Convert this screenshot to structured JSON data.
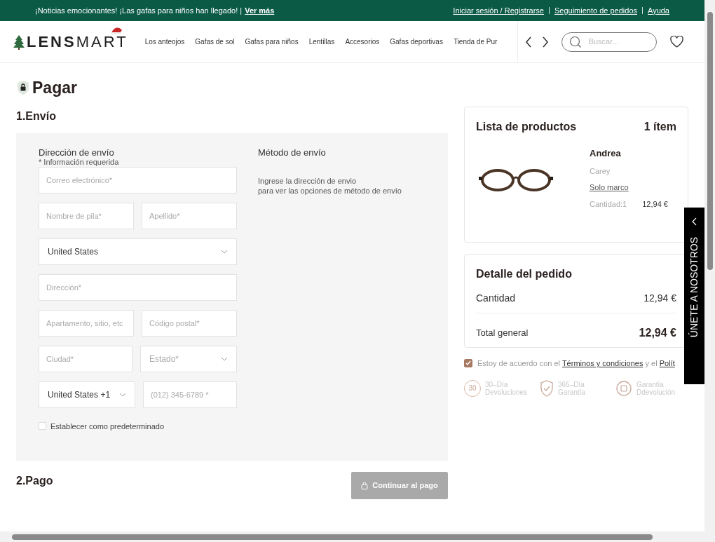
{
  "announcement": {
    "text": "¡Noticias emocionantes! ¡Las gafas para niños han llegado! |",
    "link": "Ver más"
  },
  "top_links": [
    "Iniciar sesión / Registrarse",
    "Seguimiento de pedidos",
    "Ayuda"
  ],
  "logo": {
    "bold": "LENS",
    "light": "MART"
  },
  "nav": [
    "Los anteojos",
    "Gafas de sol",
    "Gafas para niños",
    "Lentillas",
    "Accesorios",
    "Gafas deportivas",
    "Tienda de Pur"
  ],
  "search": {
    "placeholder": "Buscar..."
  },
  "page_title": "Pagar",
  "shipping": {
    "heading": "1.Envío",
    "address_title": "Dirección de envío",
    "required_note": "* Información requerida",
    "rows": [
      [
        {
          "kind": "input",
          "placeholder": "Correo electrónico*"
        }
      ],
      [
        {
          "kind": "input",
          "placeholder": "Nombre de pila*"
        },
        {
          "kind": "input",
          "placeholder": "Apellido*"
        }
      ],
      [
        {
          "kind": "select",
          "value": "United States"
        }
      ],
      [
        {
          "kind": "input",
          "placeholder": "Dirección*"
        }
      ],
      [
        {
          "kind": "input",
          "placeholder": "Apartamento, sitio, etc"
        },
        {
          "kind": "input",
          "placeholder": "Código postal*"
        }
      ],
      [
        {
          "kind": "input",
          "placeholder": "Ciudad*"
        },
        {
          "kind": "select",
          "placeholder": "Estado*"
        }
      ],
      [
        {
          "kind": "select",
          "value": "United States +1"
        },
        {
          "kind": "input",
          "placeholder": "(012) 345-6789 *"
        }
      ]
    ],
    "default_checkbox": {
      "label": "Establecer como predeterminado",
      "checked": false
    },
    "method_title": "Método de envío",
    "method_note": [
      "Ingrese la dirección de envio",
      "para ver las opciones de método de envío"
    ]
  },
  "payment": {
    "heading": "2.Pago",
    "button": {
      "label": "Continuar al pago",
      "disabled": true
    }
  },
  "product_list": {
    "title": "Lista de productos",
    "count": "1 ítem",
    "items": [
      {
        "name": "Andrea",
        "variant": "Carey",
        "lens": "Solo marco",
        "quantity": "Cantidad:1",
        "price": "12,94 €"
      }
    ]
  },
  "order_detail": {
    "title": "Detalle del pedido",
    "rows": [
      {
        "kind": "subtotal",
        "label": "Cantidad",
        "value": "12,94 €"
      },
      {
        "kind": "total",
        "label": "Total general",
        "value": "12,94 €"
      }
    ]
  },
  "terms": {
    "checked": true,
    "text": "Estoy de acuerdo con el",
    "link1": "Términos y condiciones",
    "middle": "y el",
    "link2": "Polít"
  },
  "badges": [
    {
      "kind": "returns",
      "icon_text": "30",
      "line1": "30–Día",
      "line2": "Devoluciones"
    },
    {
      "kind": "warranty",
      "line1": "365–Día",
      "line2": "Garantía"
    },
    {
      "kind": "refund",
      "line1": "Garantía",
      "line2": "Ddevolución"
    }
  ],
  "side_tab": {
    "label": "ÚNETE A NOSOTROS"
  }
}
